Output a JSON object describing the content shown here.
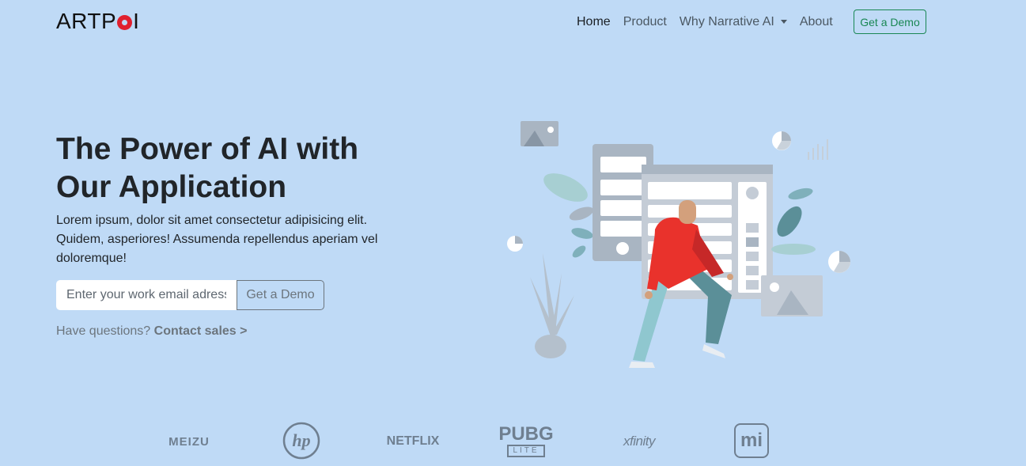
{
  "brand": {
    "pre": "ARTP",
    "post": "I"
  },
  "nav": {
    "home": "Home",
    "product": "Product",
    "why": "Why Narrative AI",
    "about": "About",
    "demo": "Get a Demo"
  },
  "hero": {
    "title": "The Power of AI with Our Application",
    "text": "Lorem ipsum, dolor sit amet consectetur adipisicing elit. Quidem, asperiores! Assumenda repellendus aperiam vel doloremque!",
    "email_placeholder": "Enter your work email adress",
    "cta": "Get a Demo",
    "contact_prefix": "Have questions?",
    "contact_link": "Contact sales >"
  },
  "logos": {
    "meizu": "MEIZU",
    "hp": "hp",
    "netflix": "NETFLIX",
    "pubg": "PUBG",
    "pubg_sub": "LITE",
    "xfinity": "xfinity",
    "mi": "mi"
  },
  "colors": {
    "background": "#bfdaf6",
    "accent_green": "#198754",
    "brand_red": "#e0202f"
  }
}
